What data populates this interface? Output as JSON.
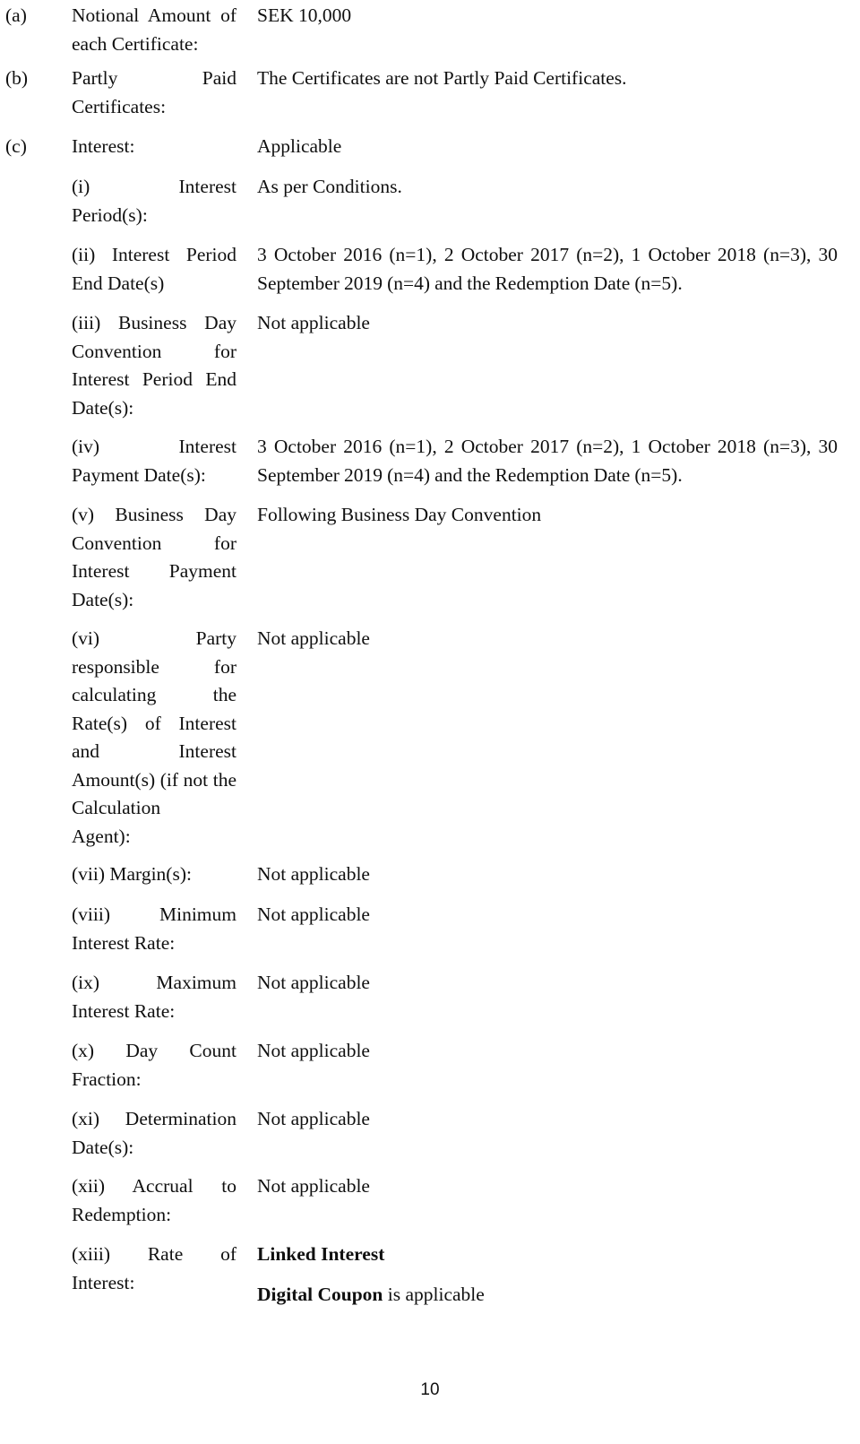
{
  "document": {
    "type": "final-terms-prospectus-page",
    "page_number": "10"
  },
  "rows": [
    {
      "marker": "(a)",
      "label_lines": [
        "Notional Amount of",
        "each Certificate:"
      ],
      "label_full": "Notional Amount of each Certificate:",
      "value": "SEK 10,000"
    },
    {
      "marker": "(b)",
      "label_lines": [
        "Partly Paid",
        "Certificates:"
      ],
      "label_full": "Partly Paid Certificates:",
      "value": "The Certificates are not Partly Paid Certificates."
    },
    {
      "marker": "(c)",
      "label_lines": [
        "Interest:"
      ],
      "label_full": "Interest:",
      "value": "Applicable"
    },
    {
      "marker": "",
      "label_lines": [
        "(i) Interest",
        "Period(s):"
      ],
      "label_full": "(i) Interest Period(s):",
      "value": "As per Conditions."
    },
    {
      "marker": "",
      "label_lines": [
        "(ii) Interest Period",
        "End Date(s)"
      ],
      "label_full": "(ii) Interest Period End Date(s)",
      "value": "3 October 2016 (n=1), 2 October 2017 (n=2), 1 October 2018 (n=3), 30 September 2019 (n=4) and the Redemption Date (n=5)."
    },
    {
      "marker": "",
      "label_lines": [
        "(iii) Business Day",
        "Convention for",
        "Interest Period End",
        "Date(s):"
      ],
      "label_full": "(iii) Business Day Convention for Interest Period End Date(s):",
      "value": "Not applicable"
    },
    {
      "marker": "",
      "label_lines": [
        "(iv) Interest",
        "Payment Date(s):"
      ],
      "label_full": "(iv) Interest Payment Date(s):",
      "value": "3 October 2016 (n=1), 2 October 2017 (n=2), 1 October 2018 (n=3), 30 September 2019 (n=4) and the Redemption Date (n=5)."
    },
    {
      "marker": "",
      "label_lines": [
        "(v) Business Day",
        "Convention for",
        "Interest Payment",
        "Date(s):"
      ],
      "label_full": "(v) Business Day Convention for Interest Payment Date(s):",
      "value": "Following Business Day Convention"
    },
    {
      "marker": "",
      "label_lines": [
        "(vi) Party",
        "responsible for",
        "calculating the",
        "Rate(s) of Interest",
        "and Interest",
        "Amount(s) (if not",
        "the Calculation",
        "Agent):"
      ],
      "label_full": "(vi) Party responsible for calculating the Rate(s) of Interest and Interest Amount(s) (if not the Calculation Agent):",
      "value": "Not applicable"
    },
    {
      "marker": "",
      "label_lines": [
        "(vii) Margin(s):"
      ],
      "label_full": "(vii) Margin(s):",
      "value": "Not applicable"
    },
    {
      "marker": "",
      "label_lines": [
        "(viii) Minimum",
        "Interest Rate:"
      ],
      "label_full": "(viii) Minimum Interest Rate:",
      "value": "Not applicable"
    },
    {
      "marker": "",
      "label_lines": [
        "(ix) Maximum",
        "Interest Rate:"
      ],
      "label_full": "(ix) Maximum Interest Rate:",
      "value": "Not applicable"
    },
    {
      "marker": "",
      "label_lines": [
        "(x) Day Count",
        "Fraction:"
      ],
      "label_full": "(x) Day Count Fraction:",
      "value": "Not applicable"
    },
    {
      "marker": "",
      "label_lines": [
        "(xi) Determination",
        "Date(s):"
      ],
      "label_full": "(xi) Determination Date(s):",
      "value": "Not applicable"
    },
    {
      "marker": "",
      "label_lines": [
        "(xii) Accrual to",
        "Redemption:"
      ],
      "label_full": "(xii) Accrual to Redemption:",
      "value": "Not applicable"
    },
    {
      "marker": "",
      "label_lines": [
        "(xiii) Rate of",
        "Interest:"
      ],
      "label_full": "(xiii) Rate of Interest:",
      "value_line1_bold": "Linked Interest",
      "value_line2_bold": "Digital Coupon",
      "value_line2_rest": " is applicable"
    }
  ],
  "footer": {
    "page_number": "10"
  }
}
